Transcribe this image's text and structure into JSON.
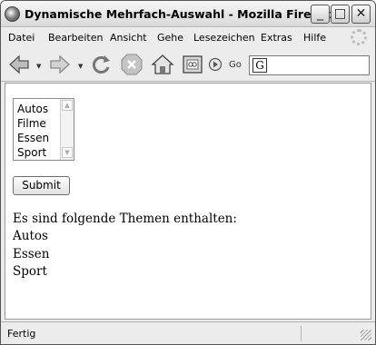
{
  "window": {
    "title": "Dynamische Mehrfach-Auswahl - Mozilla Firefox",
    "minimize_glyph": "_",
    "maximize_glyph": "□",
    "close_glyph": "✕"
  },
  "menu": {
    "items": [
      {
        "label": "Datei"
      },
      {
        "label": "Bearbeiten"
      },
      {
        "label": "Ansicht"
      },
      {
        "label": "Gehe"
      },
      {
        "label": "Lesezeichen"
      },
      {
        "label": "Extras"
      },
      {
        "label": "Hilfe"
      }
    ]
  },
  "toolbar": {
    "go_label": "Go",
    "url_value": "",
    "icons": [
      "back-icon",
      "forward-icon",
      "reload-icon",
      "stop-icon",
      "home-icon",
      "bookmarks-icon",
      "go-icon",
      "favicon-icon"
    ]
  },
  "form": {
    "options": [
      {
        "label": "Autos"
      },
      {
        "label": "Filme"
      },
      {
        "label": "Essen"
      },
      {
        "label": "Sport"
      }
    ],
    "submit_label": "Submit"
  },
  "result": {
    "heading": "Es sind folgende Themen enthalten:",
    "items": [
      {
        "label": "Autos"
      },
      {
        "label": "Essen"
      },
      {
        "label": "Sport"
      }
    ]
  },
  "status": {
    "text": "Fertig"
  }
}
